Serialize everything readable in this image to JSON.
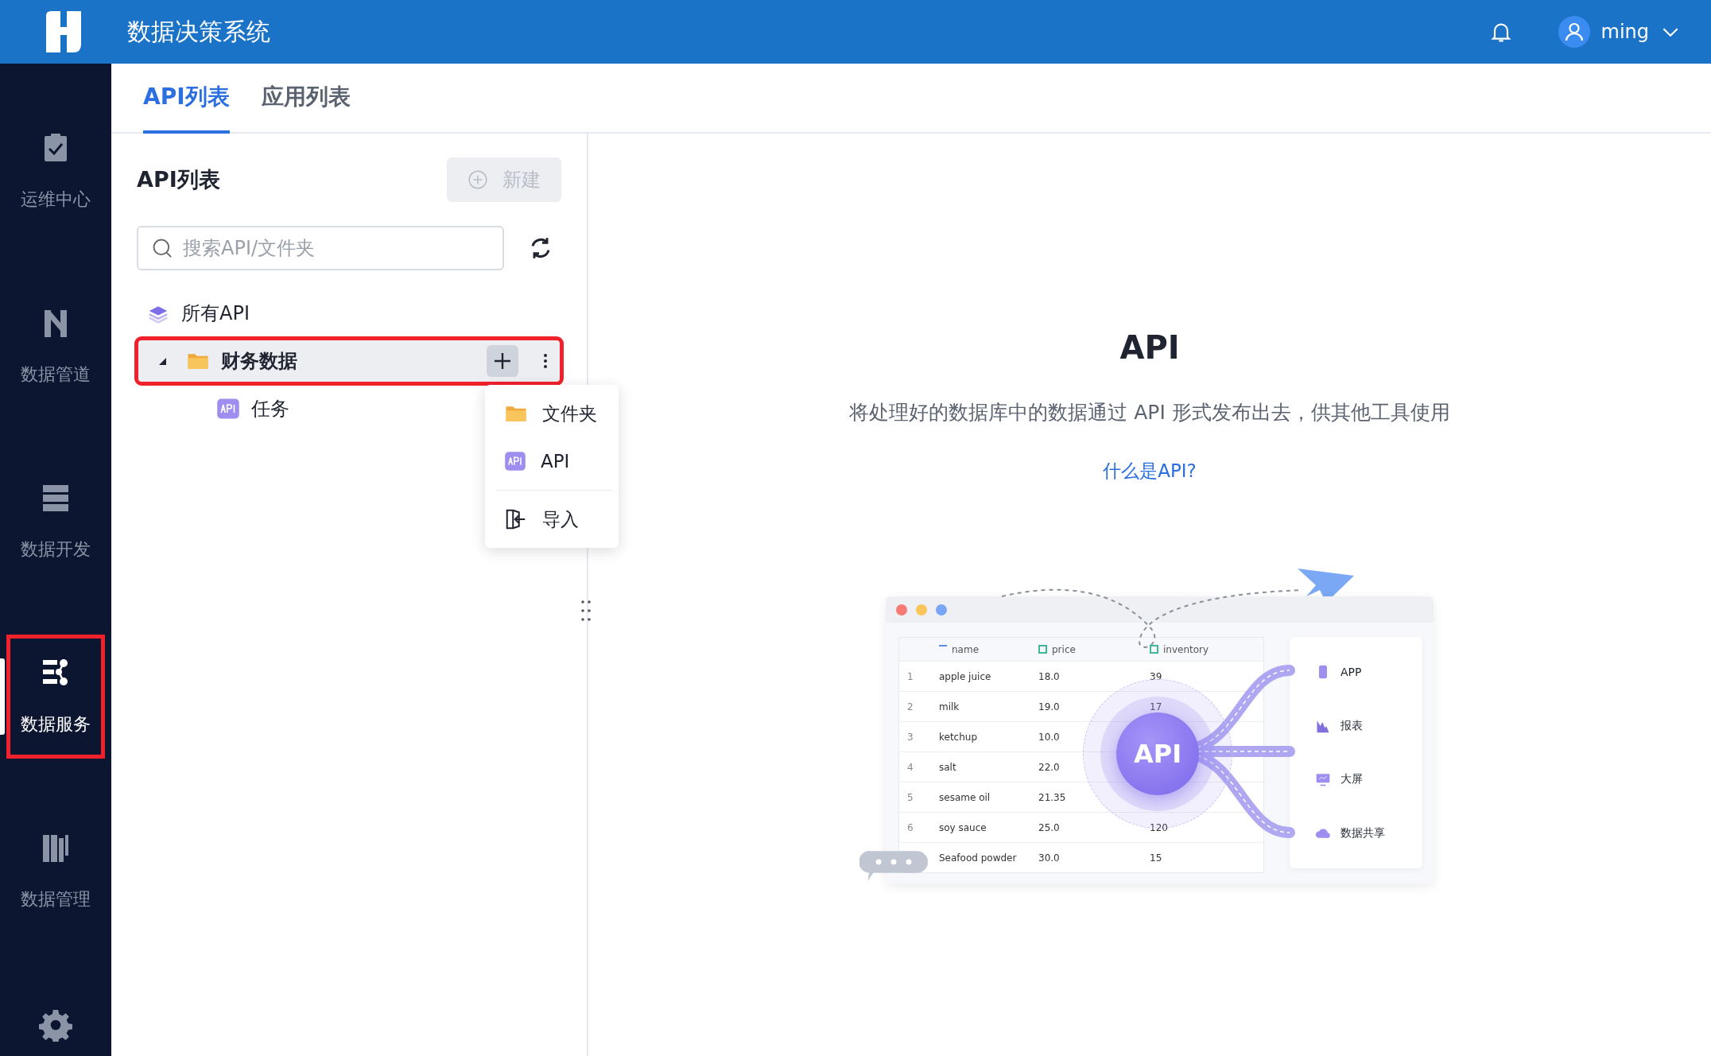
{
  "header": {
    "title": "数据决策系统",
    "user": "ming"
  },
  "sidebar": {
    "items": [
      {
        "label": "运维中心",
        "kind": "ops",
        "selected": false,
        "annotated": false
      },
      {
        "label": "数据管道",
        "kind": "pipe",
        "selected": false,
        "annotated": false
      },
      {
        "label": "数据开发",
        "kind": "dev",
        "selected": false,
        "annotated": false
      },
      {
        "label": "数据服务",
        "kind": "service",
        "selected": true,
        "annotated": true
      },
      {
        "label": "数据管理",
        "kind": "manage",
        "selected": false,
        "annotated": false
      }
    ]
  },
  "tabs": [
    {
      "label": "API列表",
      "selected": true
    },
    {
      "label": "应用列表",
      "selected": false
    }
  ],
  "panel": {
    "title": "API列表",
    "new_button": {
      "label": "新建",
      "disabled": true
    },
    "search": {
      "placeholder": "搜索API/文件夹"
    },
    "tree": [
      {
        "label": "所有API",
        "kind": "all",
        "selected": false,
        "annotated": false
      },
      {
        "label": "财务数据",
        "kind": "folder",
        "selected": true,
        "annotated": true,
        "expanded": true,
        "children": [
          {
            "label": "任务",
            "kind": "api",
            "selected": false,
            "annotated": false
          }
        ]
      }
    ]
  },
  "context_menu": {
    "items": [
      {
        "label": "文件夹",
        "kind": "folder"
      },
      {
        "label": "API",
        "kind": "api"
      },
      {
        "label": "导入",
        "kind": "import"
      }
    ]
  },
  "intro": {
    "title": "API",
    "description": "将处理好的数据库中的数据通过 API 形式发布出去，供其他工具使用",
    "link": "什么是API?"
  },
  "illustration": {
    "columns": [
      "name",
      "price",
      "inventory"
    ],
    "rows": [
      {
        "no": "1",
        "name": "apple juice",
        "price": "18.0",
        "inventory": "39"
      },
      {
        "no": "2",
        "name": "milk",
        "price": "19.0",
        "inventory": "17"
      },
      {
        "no": "3",
        "name": "ketchup",
        "price": "10.0"
      },
      {
        "no": "4",
        "name": "salt",
        "price": "22.0"
      },
      {
        "no": "5",
        "name": "sesame oil",
        "price": "21.35"
      },
      {
        "no": "6",
        "name": "soy sauce",
        "price": "25.0",
        "inventory": "120"
      },
      {
        "name": "Seafood powder",
        "price": "30.0",
        "inventory": "15"
      }
    ],
    "center": "API",
    "targets": [
      {
        "label": "APP",
        "kind": "app"
      },
      {
        "label": "报表",
        "kind": "report"
      },
      {
        "label": "大屏",
        "kind": "screen"
      },
      {
        "label": "数据共享",
        "kind": "share"
      }
    ]
  }
}
